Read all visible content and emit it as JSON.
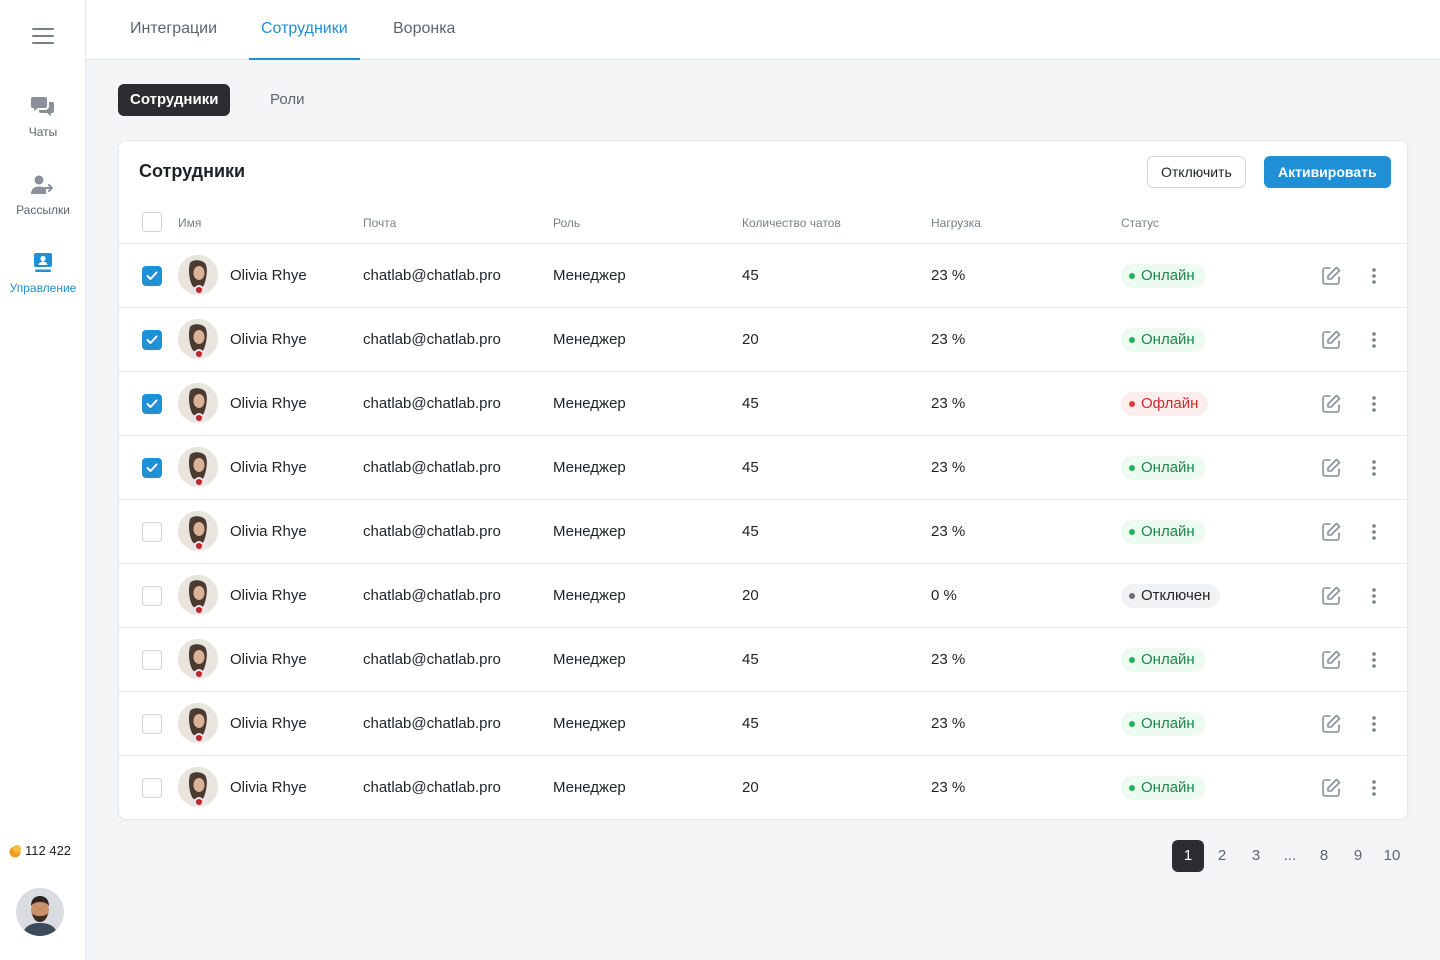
{
  "sidebar": {
    "items": [
      {
        "label": "Чаты",
        "icon": "chat-bubbles-icon"
      },
      {
        "label": "Рассылки",
        "icon": "users-send-icon"
      },
      {
        "label": "Управление",
        "icon": "management-icon"
      }
    ],
    "balance": "112 422"
  },
  "top_tabs": [
    "Интеграции",
    "Сотрудники",
    "Воронка"
  ],
  "active_top_tab": "Сотрудники",
  "sub_tabs": [
    "Сотрудники",
    "Роли"
  ],
  "card": {
    "title": "Сотрудники",
    "disable_label": "Отключить",
    "activate_label": "Активировать",
    "columns": [
      "Имя",
      "Почта",
      "Роль",
      "Количество чатов",
      "Нагрузка",
      "Статус"
    ]
  },
  "rows": [
    {
      "checked": true,
      "name": "Olivia Rhye",
      "email": "chatlab@chatlab.pro",
      "role": "Менеджер",
      "chats": "45",
      "load": "23 %",
      "status": "Онлайн",
      "status_type": "online"
    },
    {
      "checked": true,
      "name": "Olivia Rhye",
      "email": "chatlab@chatlab.pro",
      "role": "Менеджер",
      "chats": "20",
      "load": "23 %",
      "status": "Онлайн",
      "status_type": "online"
    },
    {
      "checked": true,
      "name": "Olivia Rhye",
      "email": "chatlab@chatlab.pro",
      "role": "Менеджер",
      "chats": "45",
      "load": "23 %",
      "status": "Офлайн",
      "status_type": "offline"
    },
    {
      "checked": true,
      "name": "Olivia Rhye",
      "email": "chatlab@chatlab.pro",
      "role": "Менеджер",
      "chats": "45",
      "load": "23 %",
      "status": "Онлайн",
      "status_type": "online"
    },
    {
      "checked": false,
      "name": "Olivia Rhye",
      "email": "chatlab@chatlab.pro",
      "role": "Менеджер",
      "chats": "45",
      "load": "23 %",
      "status": "Онлайн",
      "status_type": "online"
    },
    {
      "checked": false,
      "name": "Olivia Rhye",
      "email": "chatlab@chatlab.pro",
      "role": "Менеджер",
      "chats": "20",
      "load": "0 %",
      "status": "Отключен",
      "status_type": "disabled"
    },
    {
      "checked": false,
      "name": "Olivia Rhye",
      "email": "chatlab@chatlab.pro",
      "role": "Менеджер",
      "chats": "45",
      "load": "23 %",
      "status": "Онлайн",
      "status_type": "online"
    },
    {
      "checked": false,
      "name": "Olivia Rhye",
      "email": "chatlab@chatlab.pro",
      "role": "Менеджер",
      "chats": "45",
      "load": "23 %",
      "status": "Онлайн",
      "status_type": "online"
    },
    {
      "checked": false,
      "name": "Olivia Rhye",
      "email": "chatlab@chatlab.pro",
      "role": "Менеджер",
      "chats": "20",
      "load": "23 %",
      "status": "Онлайн",
      "status_type": "online"
    }
  ],
  "pagination": {
    "pages": [
      "1",
      "2",
      "3",
      "...",
      "8",
      "9",
      "10"
    ],
    "current": "1"
  },
  "colors": {
    "accent": "#1f8fd6",
    "dark": "#2b2d30",
    "online": "#16884a",
    "offline": "#d12a2a"
  }
}
